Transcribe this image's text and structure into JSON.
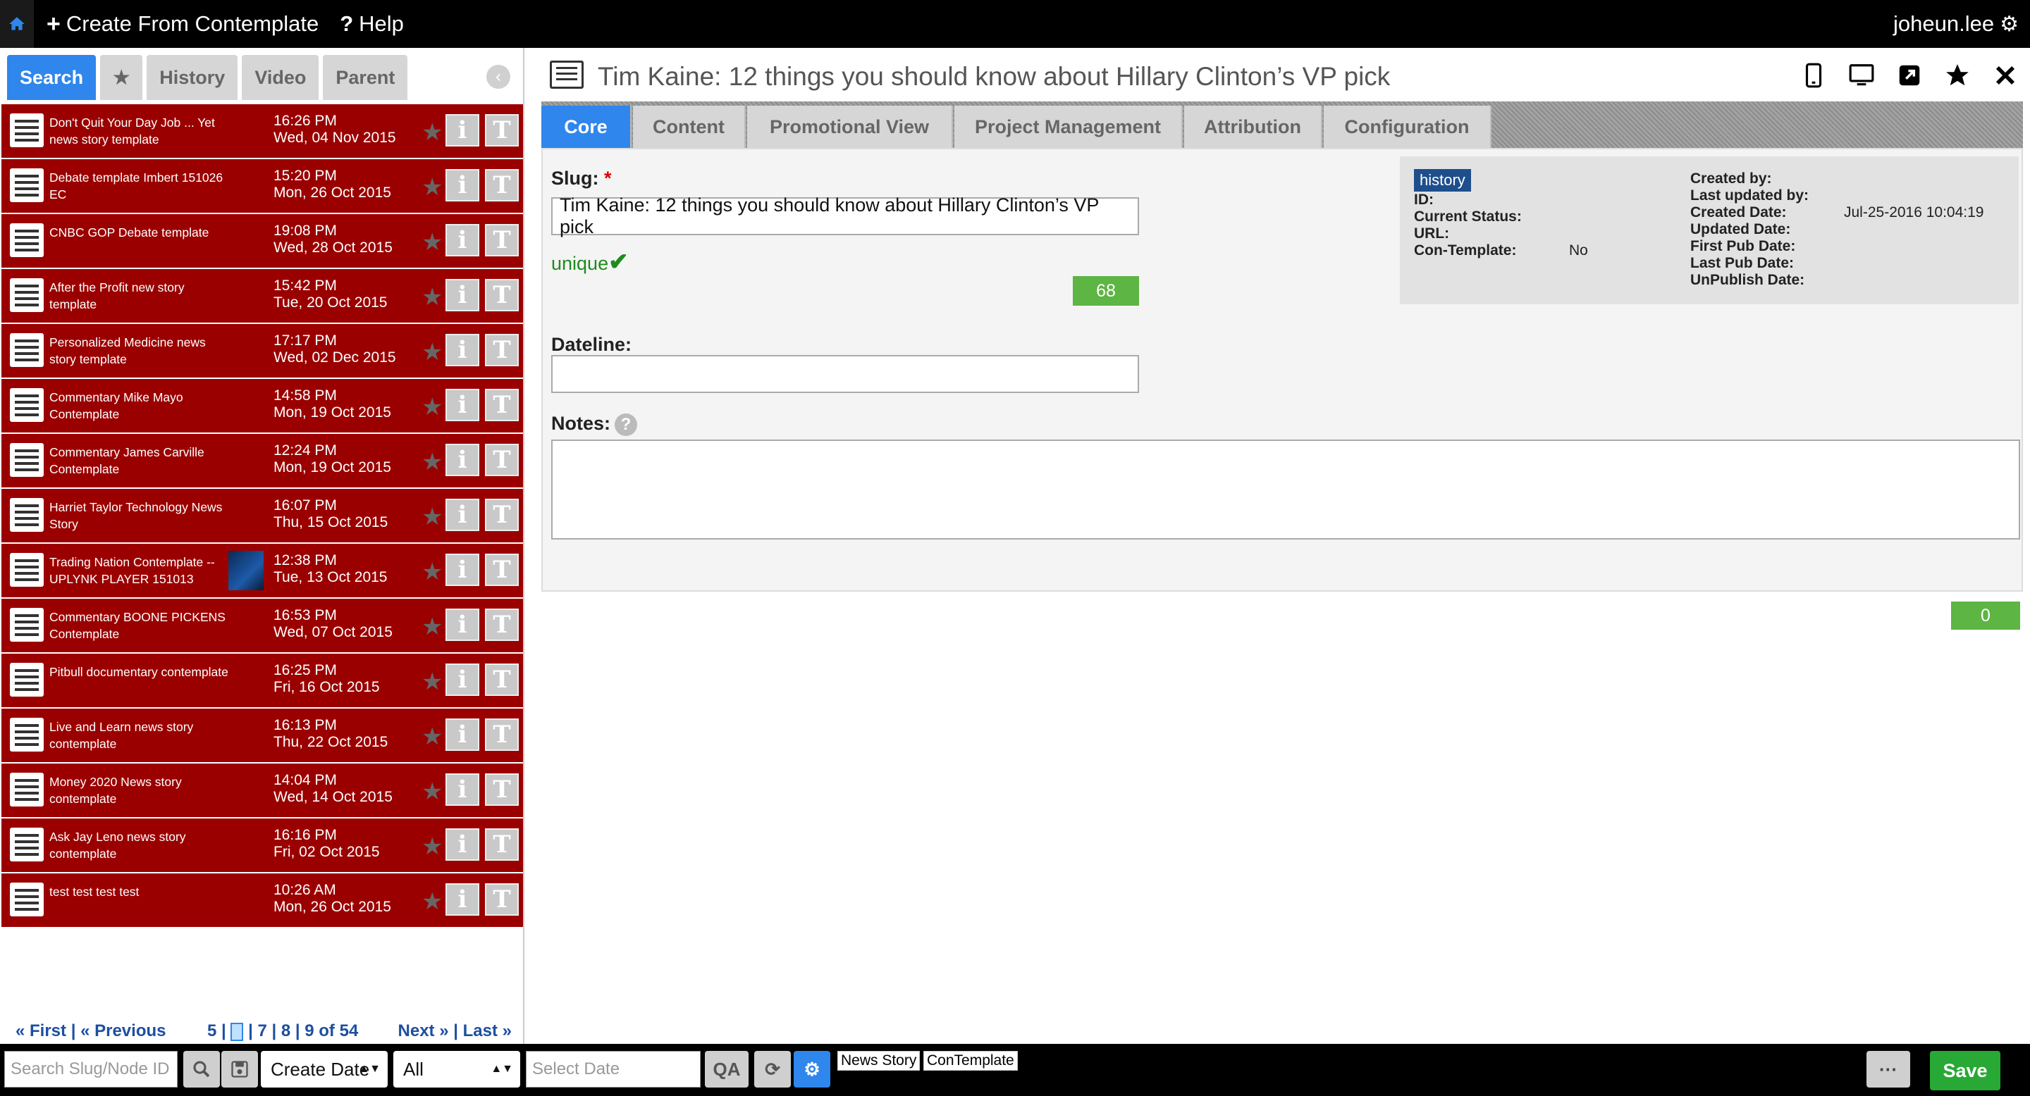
{
  "topbar": {
    "create_label": "Create From Contemplate",
    "help_label": "Help",
    "user": "joheun.lee"
  },
  "left": {
    "tabs": [
      "Search",
      "★",
      "History",
      "Video",
      "Parent"
    ],
    "items": [
      {
        "title": "Don't Quit Your Day Job ... Yet news story template",
        "time": "16:26 PM",
        "date": "Wed, 04 Nov 2015",
        "thumb": false
      },
      {
        "title": "Debate template Imbert 151026 EC",
        "time": "15:20 PM",
        "date": "Mon, 26 Oct 2015",
        "thumb": false
      },
      {
        "title": "CNBC GOP Debate template",
        "time": "19:08 PM",
        "date": "Wed, 28 Oct 2015",
        "thumb": false
      },
      {
        "title": "After the Profit new story template",
        "time": "15:42 PM",
        "date": "Tue, 20 Oct 2015",
        "thumb": false
      },
      {
        "title": "Personalized Medicine news story template",
        "time": "17:17 PM",
        "date": "Wed, 02 Dec 2015",
        "thumb": false
      },
      {
        "title": "Commentary Mike Mayo Contemplate",
        "time": "14:58 PM",
        "date": "Mon, 19 Oct 2015",
        "thumb": false
      },
      {
        "title": "Commentary James Carville Contemplate",
        "time": "12:24 PM",
        "date": "Mon, 19 Oct 2015",
        "thumb": false
      },
      {
        "title": "Harriet Taylor Technology News Story",
        "time": "16:07 PM",
        "date": "Thu, 15 Oct 2015",
        "thumb": false
      },
      {
        "title": "Trading Nation Contemplate -- UPLYNK PLAYER 151013",
        "time": "12:38 PM",
        "date": "Tue, 13 Oct 2015",
        "thumb": true
      },
      {
        "title": "Commentary BOONE PICKENS Contemplate",
        "time": "16:53 PM",
        "date": "Wed, 07 Oct 2015",
        "thumb": false
      },
      {
        "title": "Pitbull documentary contemplate",
        "time": "16:25 PM",
        "date": "Fri, 16 Oct 2015",
        "thumb": false
      },
      {
        "title": "Live and Learn news story contemplate",
        "time": "16:13 PM",
        "date": "Thu, 22 Oct 2015",
        "thumb": false
      },
      {
        "title": "Money 2020 News story contemplate",
        "time": "14:04 PM",
        "date": "Wed, 14 Oct 2015",
        "thumb": false
      },
      {
        "title": "Ask Jay Leno news story contemplate",
        "time": "16:16 PM",
        "date": "Fri, 02 Oct 2015",
        "thumb": false
      },
      {
        "title": "test test test test",
        "time": "10:26 AM",
        "date": "Mon, 26 Oct 2015",
        "thumb": false
      }
    ],
    "pager": {
      "first": "« First",
      "prev": "« Previous",
      "page_before": "5 |",
      "page_after": "| 7 | 8 | 9 of 54",
      "next": "Next »",
      "last": "Last »"
    }
  },
  "main": {
    "title": "Tim Kaine: 12 things you should know about Hillary Clinton’s VP pick",
    "tabs": [
      "Core",
      "Content",
      "Promotional View",
      "Project Management",
      "Attribution",
      "Configuration"
    ],
    "slug_label": "Slug:",
    "slug_required": "*",
    "slug_value": "Tim Kaine: 12 things you should know about Hillary Clinton’s VP pick",
    "unique_label": "unique",
    "slug_count": "68",
    "dateline_label": "Dateline:",
    "dateline_value": "",
    "notes_label": "Notes:",
    "notes_count": "0",
    "info": {
      "history_badge": "history",
      "left_labels": [
        "ID:",
        "Current Status:",
        "URL:",
        "Con-Template:"
      ],
      "con_template_value": "No",
      "right_labels": [
        "Created by:",
        "Last updated by:",
        "Created Date:",
        "Updated Date:",
        "First Pub Date:",
        "Last Pub Date:",
        "UnPublish Date:"
      ],
      "created_date_value": "Jul-25-2016 10:04:19"
    }
  },
  "bottombar": {
    "search_placeholder": "Search Slug/Node ID",
    "sort_select": "Create Date",
    "filter_select": "All",
    "date_placeholder": "Select Date",
    "qa_label": "QA",
    "tags": [
      "News Story",
      "ConTemplate"
    ],
    "more_label": "···",
    "save_label": "Save"
  },
  "colors": {
    "accent": "#2f86ec",
    "item_bg": "#9b0000",
    "success": "#5db543",
    "save": "#28a835"
  }
}
